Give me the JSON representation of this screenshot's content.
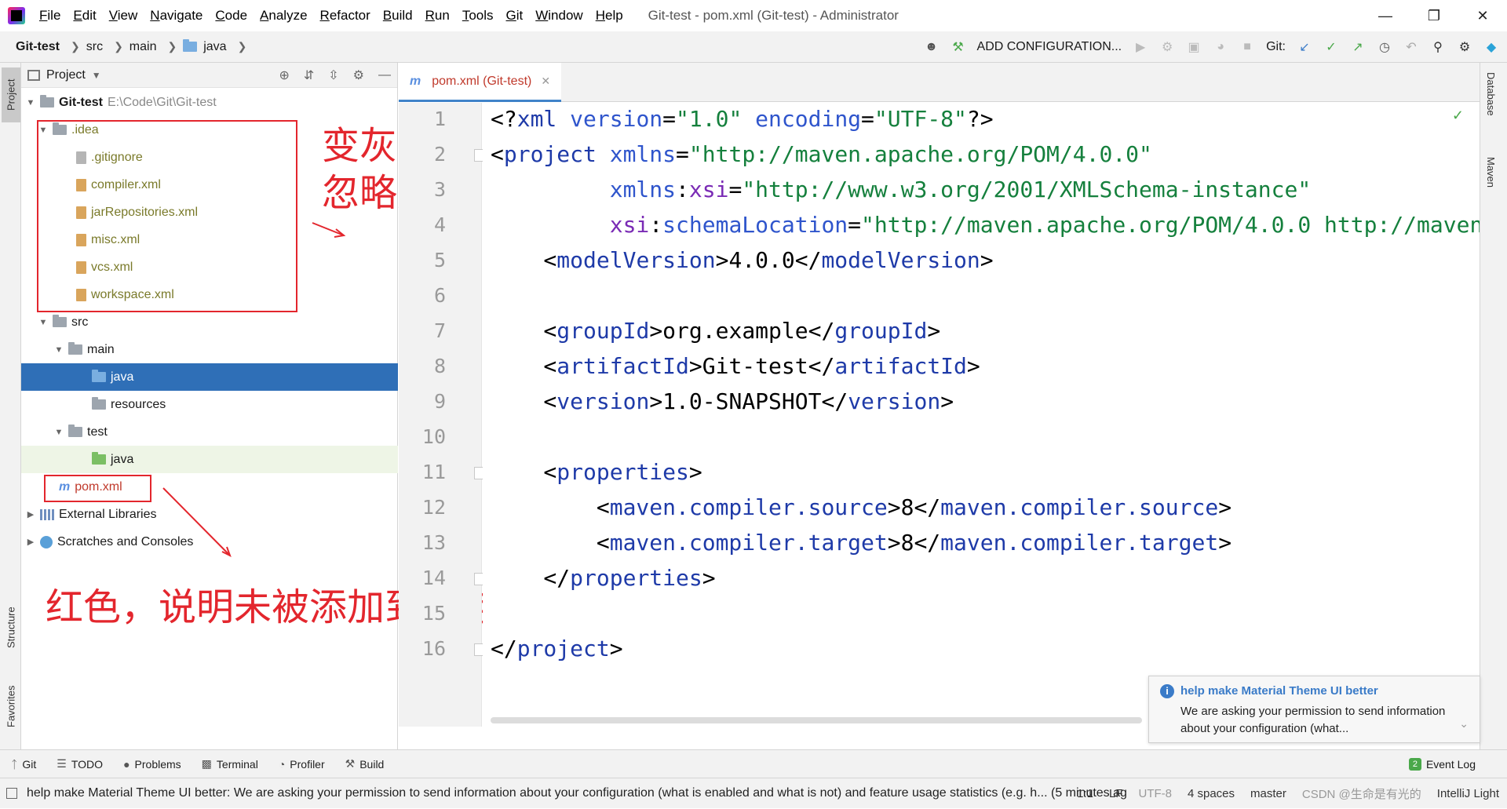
{
  "menu": {
    "items": [
      "File",
      "Edit",
      "View",
      "Navigate",
      "Code",
      "Analyze",
      "Refactor",
      "Build",
      "Run",
      "Tools",
      "Git",
      "Window",
      "Help"
    ],
    "window_title": "Git-test - pom.xml (Git-test) - Administrator"
  },
  "breadcrumb": {
    "project": "Git-test",
    "src": "src",
    "main": "main",
    "java": "java"
  },
  "toolbar": {
    "add_configuration": "ADD CONFIGURATION...",
    "git_label": "Git:"
  },
  "side_tabs": {
    "project": "Project",
    "structure": "Structure",
    "favorites": "Favorites",
    "database": "Database",
    "maven": "Maven"
  },
  "project_panel": {
    "title": "Project",
    "root_name": "Git-test",
    "root_path": "E:\\Code\\Git\\Git-test",
    "idea": ".idea",
    "gitignore": ".gitignore",
    "compiler": "compiler.xml",
    "jar_repos": "jarRepositories.xml",
    "misc": "misc.xml",
    "vcs": "vcs.xml",
    "workspace": "workspace.xml",
    "src": "src",
    "main": "main",
    "java": "java",
    "resources": "resources",
    "test": "test",
    "test_java": "java",
    "pom": "pom.xml",
    "external_libs": "External Libraries",
    "scratches": "Scratches and Consoles"
  },
  "annotations": {
    "gray_line1": "变灰",
    "gray_line2": "忽略成功",
    "red_note": "红色，说明未被添加到暂存区"
  },
  "editor": {
    "tab_label": "pom.xml (Git-test)",
    "line_numbers": [
      "1",
      "2",
      "3",
      "4",
      "5",
      "6",
      "7",
      "8",
      "9",
      "10",
      "11",
      "12",
      "13",
      "14",
      "15",
      "16"
    ],
    "lines": {
      "l1_a": "<?",
      "l1_b": "xml",
      "l1_c": " version",
      "l1_d": "=",
      "l1_e": "\"1.0\"",
      "l1_f": " encoding",
      "l1_g": "=",
      "l1_h": "\"UTF-8\"",
      "l1_i": "?>",
      "l2_a": "<",
      "l2_b": "project",
      "l2_c": " xmlns",
      "l2_d": "=",
      "l2_e": "\"http://maven.apache.org/POM/4.0.0\"",
      "l3_a": "         xmlns",
      "l3_b": ":",
      "l3_c": "xsi",
      "l3_d": "=",
      "l3_e": "\"http://www.w3.org/2001/XMLSchema-instance\"",
      "l4_a": "         xsi",
      "l4_b": ":",
      "l4_c": "schemaLocation",
      "l4_d": "=",
      "l4_e": "\"http://maven.apache.org/POM/4.0.0 http://maven",
      "l5_a": "    <",
      "l5_b": "modelVersion",
      "l5_c": ">4.0.0</",
      "l5_d": "modelVersion",
      "l5_e": ">",
      "l7_a": "    <",
      "l7_b": "groupId",
      "l7_c": ">org.example</",
      "l7_d": "groupId",
      "l7_e": ">",
      "l8_a": "    <",
      "l8_b": "artifactId",
      "l8_c": ">Git-test</",
      "l8_d": "artifactId",
      "l8_e": ">",
      "l9_a": "    <",
      "l9_b": "version",
      "l9_c": ">1.0-SNAPSHOT</",
      "l9_d": "version",
      "l9_e": ">",
      "l11_a": "    <",
      "l11_b": "properties",
      "l11_c": ">",
      "l12_a": "        <",
      "l12_b": "maven.compiler.source",
      "l12_c": ">8</",
      "l12_d": "maven.compiler.source",
      "l12_e": ">",
      "l13_a": "        <",
      "l13_b": "maven.compiler.target",
      "l13_c": ">8</",
      "l13_d": "maven.compiler.target",
      "l13_e": ">",
      "l14_a": "    </",
      "l14_b": "properties",
      "l14_c": ">",
      "l16_a": "</",
      "l16_b": "project",
      "l16_c": ">"
    }
  },
  "notification": {
    "title": "help make Material Theme UI better",
    "body": "We are asking your permission to send information about your configuration (what..."
  },
  "bottom_tools": {
    "git": "Git",
    "todo": "TODO",
    "problems": "Problems",
    "terminal": "Terminal",
    "profiler": "Profiler",
    "build": "Build",
    "event_log": "Event Log"
  },
  "status": {
    "message": "help make Material Theme UI better: We are asking your permission to send information about your configuration (what is enabled and what is not) and feature usage statistics (e.g. h... (5 minutes ag",
    "position": "1:1",
    "line_sep": "LF",
    "encoding": "UTF-8",
    "indent": "4 spaces",
    "branch": "master",
    "theme": "IntelliJ Light",
    "watermark": "CSDN @生命是有光的"
  },
  "colors": {
    "selection": "#2f6fb7",
    "annotation": "#e3262d",
    "tag": "#1e3aa8",
    "value": "#15803d"
  }
}
